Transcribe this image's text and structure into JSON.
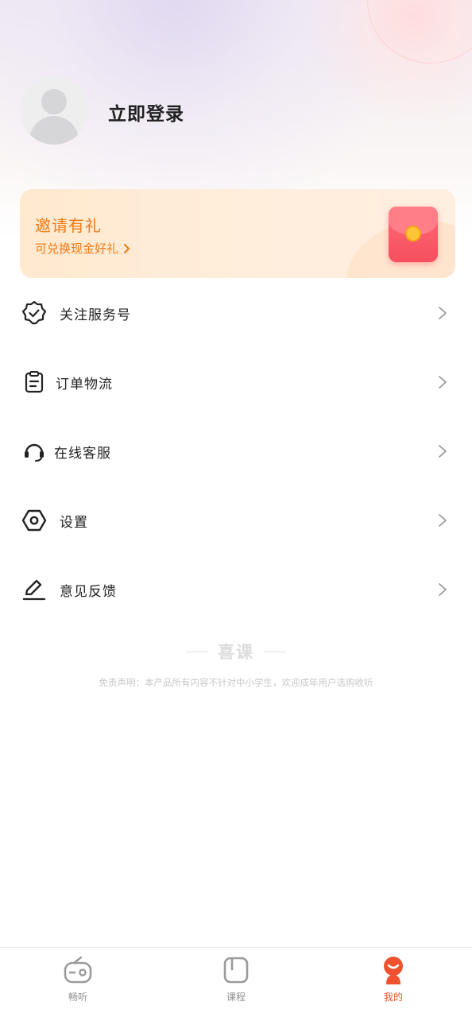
{
  "profile": {
    "login_label": "立即登录"
  },
  "invite": {
    "title": "邀请有礼",
    "subtitle": "可兑换现金好礼"
  },
  "menu": {
    "items": [
      {
        "label": "关注服务号",
        "icon": "verified-badge-icon"
      },
      {
        "label": "订单物流",
        "icon": "clipboard-icon"
      },
      {
        "label": "在线客服",
        "icon": "headset-icon"
      },
      {
        "label": "设置",
        "icon": "settings-hex-icon"
      },
      {
        "label": "意见反馈",
        "icon": "edit-pen-icon"
      }
    ]
  },
  "footer": {
    "brand": "喜课",
    "disclaimer": "免责声明：本产品所有内容不针对中小学生，欢迎成年用户选购收听"
  },
  "bottom_nav": {
    "items": [
      {
        "label": "畅听",
        "icon": "radio-icon",
        "active": false
      },
      {
        "label": "课程",
        "icon": "book-icon",
        "active": false
      },
      {
        "label": "我的",
        "icon": "profile-mascot-icon",
        "active": true
      }
    ]
  },
  "colors": {
    "accent_orange": "#f07a14",
    "active_tab": "#f0522f",
    "banner_bg": "#ffe9cf"
  }
}
